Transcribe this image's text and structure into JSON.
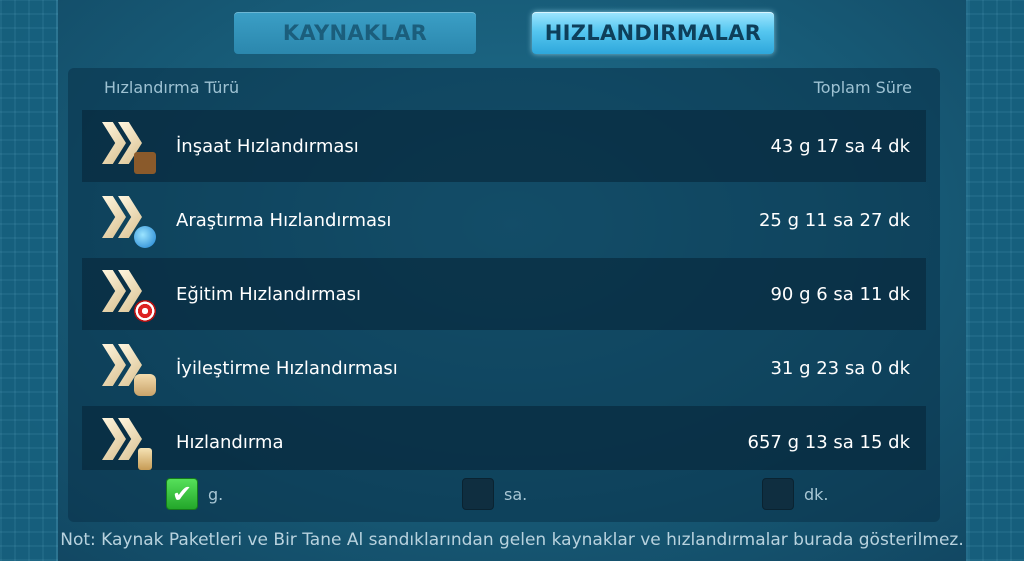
{
  "tabs": {
    "resources": "KAYNAKLAR",
    "speedups": "HIZLANDIRMALAR",
    "active": "speedups"
  },
  "table": {
    "header_type": "Hızlandırma Türü",
    "header_total": "Toplam Süre",
    "rows": [
      {
        "name": "İnşaat Hızlandırması",
        "value": "43 g 17 sa 4 dk",
        "icon": "construction-speedup-icon"
      },
      {
        "name": "Araştırma Hızlandırması",
        "value": "25 g 11 sa 27 dk",
        "icon": "research-speedup-icon"
      },
      {
        "name": "Eğitim Hızlandırması",
        "value": "90 g 6 sa 11 dk",
        "icon": "training-speedup-icon"
      },
      {
        "name": "İyileştirme Hızlandırması",
        "value": "31 g 23 sa 0 dk",
        "icon": "healing-speedup-icon"
      },
      {
        "name": "Hızlandırma",
        "value": "657 g 13 sa 15 dk",
        "icon": "universal-speedup-icon"
      }
    ]
  },
  "filters": {
    "days": {
      "label": "g.",
      "checked": true
    },
    "hours": {
      "label": "sa.",
      "checked": false
    },
    "minutes": {
      "label": "dk.",
      "checked": false
    }
  },
  "footnote": "Not: Kaynak Paketleri ve Bir Tane Al sandıklarından gelen kaynaklar ve hızlandırmalar burada gösterilmez.",
  "colors": {
    "background": "#175a76",
    "tab_active": "#56c7f0",
    "tab_inactive": "#2b87ad",
    "checkbox_checked": "#23a62a"
  }
}
